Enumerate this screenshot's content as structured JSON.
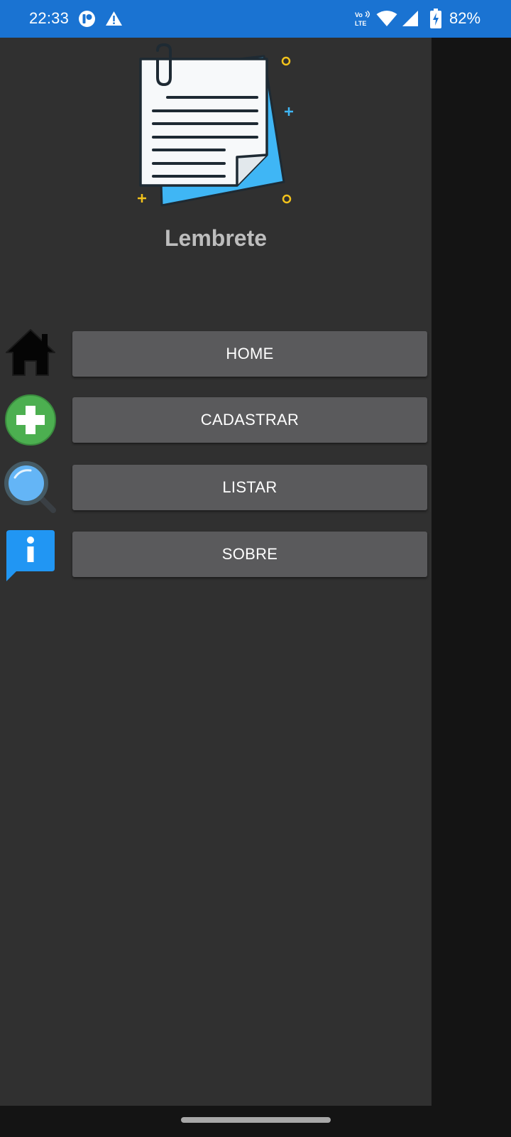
{
  "status_bar": {
    "time": "22:33",
    "battery_percent": "82%",
    "network_label": "Vo LTE",
    "icons": [
      "notification-app-icon",
      "warning-icon",
      "volte-icon",
      "wifi-icon",
      "cellular-signal-icon",
      "battery-charging-icon"
    ]
  },
  "drawer": {
    "app_title": "Lembrete",
    "logo_icon": "notepad-clipboard-logo",
    "menu": [
      {
        "label": "HOME",
        "icon": "home-icon"
      },
      {
        "label": "CADASTRAR",
        "icon": "add-icon"
      },
      {
        "label": "LISTAR",
        "icon": "search-icon"
      },
      {
        "label": "SOBRE",
        "icon": "info-icon"
      }
    ]
  },
  "colors": {
    "status_bar": "#1a73d2",
    "drawer_background": "#303030",
    "button_background": "#5a5a5c",
    "title_text": "#bdbdbd",
    "add_icon_green": "#4caf50",
    "info_icon_blue": "#2196f3"
  }
}
